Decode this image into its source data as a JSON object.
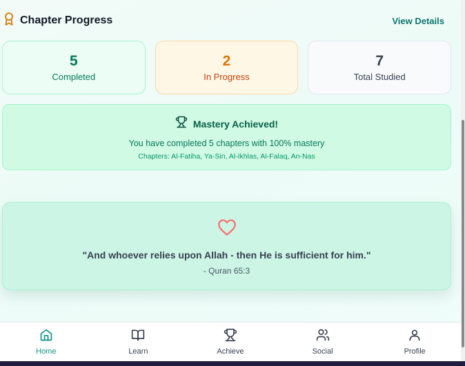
{
  "header": {
    "title": "Chapter Progress",
    "view_details": "View Details"
  },
  "stats": [
    {
      "value": "5",
      "label": "Completed"
    },
    {
      "value": "2",
      "label": "In Progress"
    },
    {
      "value": "7",
      "label": "Total Studied"
    }
  ],
  "mastery": {
    "title": "Mastery Achieved!",
    "text": "You have completed 5 chapters with 100% mastery",
    "chapters": "Chapters: Al-Fatiha, Ya-Sin, Al-Ikhlas, Al-Falaq, An-Nas"
  },
  "quote": {
    "text": "\"And whoever relies upon Allah - then He is sufficient for him.\"",
    "source": "- Quran 65:3"
  },
  "nav": [
    {
      "label": "Home",
      "icon": "home-icon",
      "active": true
    },
    {
      "label": "Learn",
      "icon": "book-icon",
      "active": false
    },
    {
      "label": "Achieve",
      "icon": "trophy-icon",
      "active": false
    },
    {
      "label": "Social",
      "icon": "users-icon",
      "active": false
    },
    {
      "label": "Profile",
      "icon": "user-icon",
      "active": false
    }
  ],
  "colors": {
    "accent": "#0d9488",
    "mastery_bg": "#d1fae5",
    "amber": "#d97706"
  }
}
